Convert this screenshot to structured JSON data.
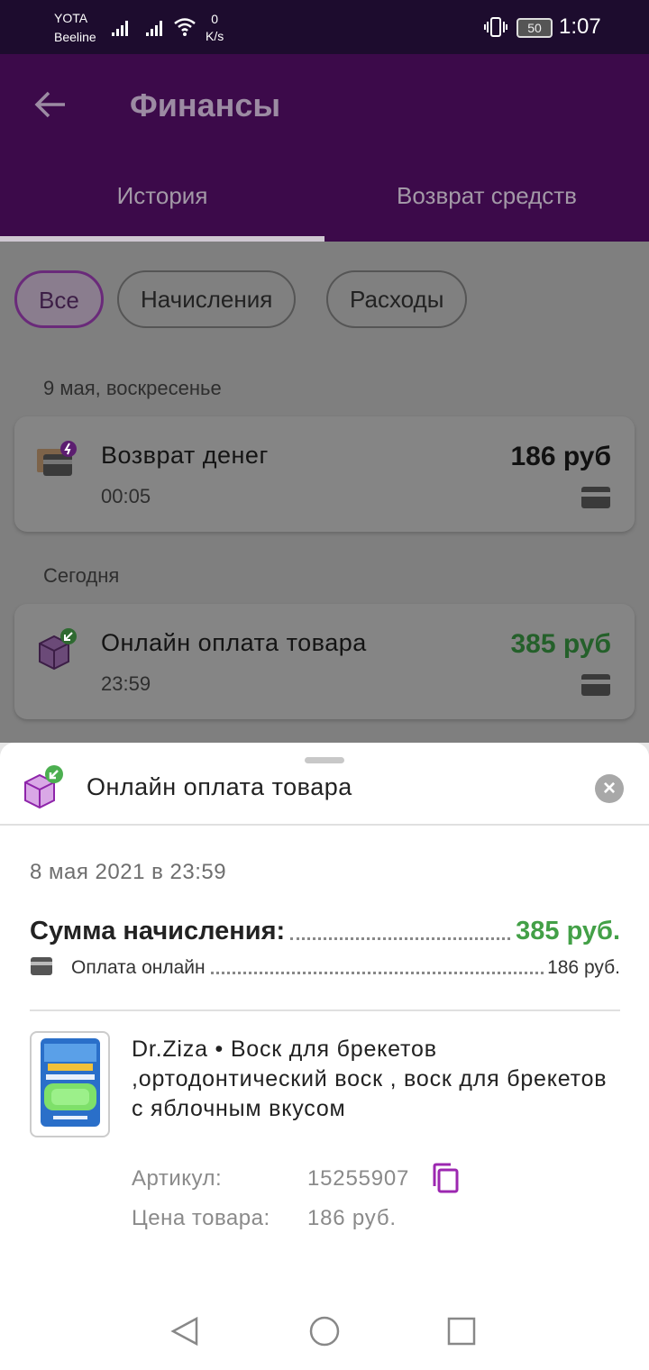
{
  "status_bar": {
    "carrier1": "YOTA",
    "carrier2": "Beeline",
    "speed_value": "0",
    "speed_unit": "K/s",
    "battery": "50",
    "time": "1:07"
  },
  "app_bar": {
    "title": "Финансы",
    "tabs": [
      {
        "label": "История",
        "active": true
      },
      {
        "label": "Возврат средств",
        "active": false
      }
    ]
  },
  "filters": {
    "chips": [
      {
        "label": "Все",
        "active": true
      },
      {
        "label": "Начисления",
        "active": false
      },
      {
        "label": "Расходы",
        "active": false
      }
    ]
  },
  "history": [
    {
      "date_label": "9 мая, воскресенье",
      "title": "Возврат денег",
      "time": "00:05",
      "amount": "186 руб",
      "amount_color": "#111111"
    },
    {
      "date_label": "Сегодня",
      "title": "Онлайн оплата товара",
      "time": "23:59",
      "amount": "385 руб",
      "amount_color": "#43a047"
    }
  ],
  "sheet": {
    "title": "Онлайн оплата товара",
    "date": "8 мая 2021 в 23:59",
    "sum_label": "Сумма начисления:",
    "sum_value": "385 руб.",
    "payment_label": "Оплата онлайн",
    "payment_value": "186 руб.",
    "product": {
      "name": "Dr.Ziza • Воск для брекетов ,ортодонтический воск , воск для брекетов с яблочным вкусом",
      "article_label": "Артикул:",
      "article_value": "15255907",
      "price_label": "Цена товара:",
      "price_value": "186 руб."
    }
  },
  "colors": {
    "accent": "#6a1b9a",
    "positive": "#43a047",
    "app_bar": "#3c0a4a"
  }
}
